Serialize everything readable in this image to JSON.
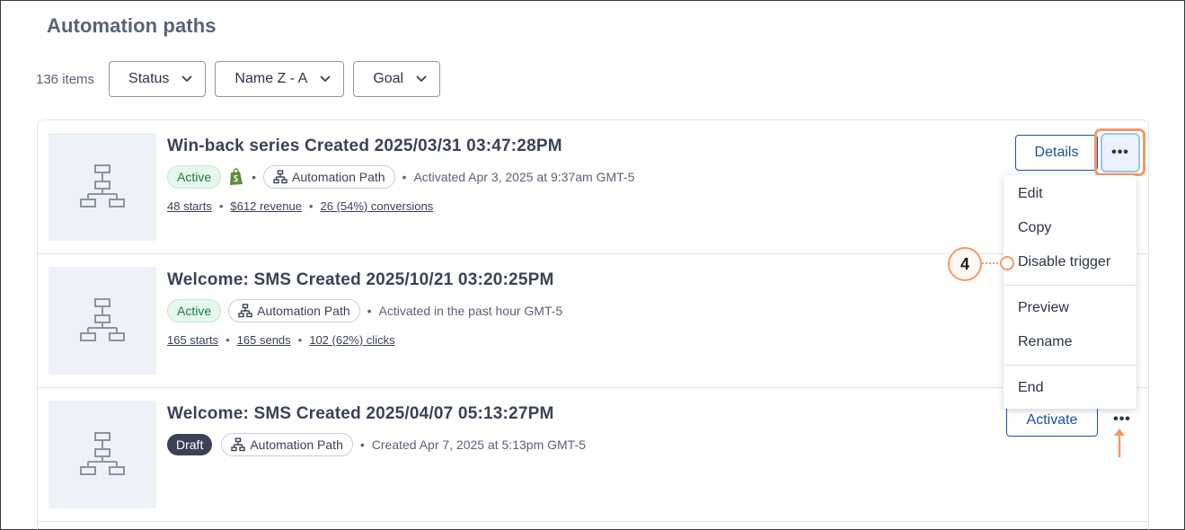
{
  "page": {
    "title": "Automation paths"
  },
  "filters": {
    "item_count": "136 items",
    "buttons": [
      {
        "label": "Status"
      },
      {
        "label": "Name Z - A"
      },
      {
        "label": "Goal"
      }
    ]
  },
  "rows": [
    {
      "title": "Win-back series Created 2025/03/31 03:47:28PM",
      "status": "Active",
      "has_shopify": true,
      "type": "Automation Path",
      "activity": "Activated Apr 3, 2025 at 9:37am GMT-5",
      "stats": [
        "48 starts",
        "$612 revenue",
        "26 (54%) conversions"
      ],
      "action": "Details"
    },
    {
      "title": "Welcome: SMS Created 2025/10/21 03:20:25PM",
      "status": "Active",
      "type": "Automation Path",
      "activity": "Activated in the past hour GMT-5",
      "stats": [
        "165 starts",
        "165 sends",
        "102 (62%) clicks"
      ]
    },
    {
      "title": "Welcome: SMS Created 2025/04/07 05:13:27PM",
      "status": "Draft",
      "type": "Automation Path",
      "activity": "Created Apr 7, 2025 at 5:13pm GMT-5",
      "action": "Activate"
    }
  ],
  "menu": {
    "items": [
      "Edit",
      "Copy",
      "Disable trigger",
      "Preview",
      "Rename",
      "End"
    ]
  },
  "callout": {
    "number": "4"
  },
  "colors": {
    "accent": "#1c4fa0",
    "highlight": "#f39a66",
    "active_badge": "#e6f7ee",
    "draft_badge": "#3b4257"
  },
  "icons": {
    "more": "more-dots-icon",
    "chevron": "chevron-down-icon",
    "flow": "flow-chart-icon",
    "shopify": "shopify-icon"
  }
}
